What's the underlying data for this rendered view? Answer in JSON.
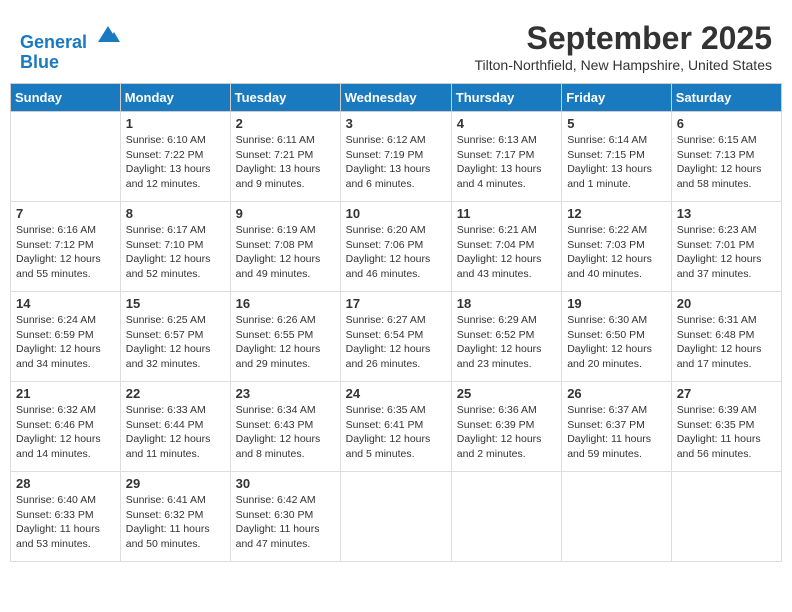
{
  "header": {
    "logo_line1": "General",
    "logo_line2": "Blue",
    "month_title": "September 2025",
    "location": "Tilton-Northfield, New Hampshire, United States"
  },
  "days_of_week": [
    "Sunday",
    "Monday",
    "Tuesday",
    "Wednesday",
    "Thursday",
    "Friday",
    "Saturday"
  ],
  "weeks": [
    [
      {
        "day": "",
        "info": ""
      },
      {
        "day": "1",
        "info": "Sunrise: 6:10 AM\nSunset: 7:22 PM\nDaylight: 13 hours\nand 12 minutes."
      },
      {
        "day": "2",
        "info": "Sunrise: 6:11 AM\nSunset: 7:21 PM\nDaylight: 13 hours\nand 9 minutes."
      },
      {
        "day": "3",
        "info": "Sunrise: 6:12 AM\nSunset: 7:19 PM\nDaylight: 13 hours\nand 6 minutes."
      },
      {
        "day": "4",
        "info": "Sunrise: 6:13 AM\nSunset: 7:17 PM\nDaylight: 13 hours\nand 4 minutes."
      },
      {
        "day": "5",
        "info": "Sunrise: 6:14 AM\nSunset: 7:15 PM\nDaylight: 13 hours\nand 1 minute."
      },
      {
        "day": "6",
        "info": "Sunrise: 6:15 AM\nSunset: 7:13 PM\nDaylight: 12 hours\nand 58 minutes."
      }
    ],
    [
      {
        "day": "7",
        "info": "Sunrise: 6:16 AM\nSunset: 7:12 PM\nDaylight: 12 hours\nand 55 minutes."
      },
      {
        "day": "8",
        "info": "Sunrise: 6:17 AM\nSunset: 7:10 PM\nDaylight: 12 hours\nand 52 minutes."
      },
      {
        "day": "9",
        "info": "Sunrise: 6:19 AM\nSunset: 7:08 PM\nDaylight: 12 hours\nand 49 minutes."
      },
      {
        "day": "10",
        "info": "Sunrise: 6:20 AM\nSunset: 7:06 PM\nDaylight: 12 hours\nand 46 minutes."
      },
      {
        "day": "11",
        "info": "Sunrise: 6:21 AM\nSunset: 7:04 PM\nDaylight: 12 hours\nand 43 minutes."
      },
      {
        "day": "12",
        "info": "Sunrise: 6:22 AM\nSunset: 7:03 PM\nDaylight: 12 hours\nand 40 minutes."
      },
      {
        "day": "13",
        "info": "Sunrise: 6:23 AM\nSunset: 7:01 PM\nDaylight: 12 hours\nand 37 minutes."
      }
    ],
    [
      {
        "day": "14",
        "info": "Sunrise: 6:24 AM\nSunset: 6:59 PM\nDaylight: 12 hours\nand 34 minutes."
      },
      {
        "day": "15",
        "info": "Sunrise: 6:25 AM\nSunset: 6:57 PM\nDaylight: 12 hours\nand 32 minutes."
      },
      {
        "day": "16",
        "info": "Sunrise: 6:26 AM\nSunset: 6:55 PM\nDaylight: 12 hours\nand 29 minutes."
      },
      {
        "day": "17",
        "info": "Sunrise: 6:27 AM\nSunset: 6:54 PM\nDaylight: 12 hours\nand 26 minutes."
      },
      {
        "day": "18",
        "info": "Sunrise: 6:29 AM\nSunset: 6:52 PM\nDaylight: 12 hours\nand 23 minutes."
      },
      {
        "day": "19",
        "info": "Sunrise: 6:30 AM\nSunset: 6:50 PM\nDaylight: 12 hours\nand 20 minutes."
      },
      {
        "day": "20",
        "info": "Sunrise: 6:31 AM\nSunset: 6:48 PM\nDaylight: 12 hours\nand 17 minutes."
      }
    ],
    [
      {
        "day": "21",
        "info": "Sunrise: 6:32 AM\nSunset: 6:46 PM\nDaylight: 12 hours\nand 14 minutes."
      },
      {
        "day": "22",
        "info": "Sunrise: 6:33 AM\nSunset: 6:44 PM\nDaylight: 12 hours\nand 11 minutes."
      },
      {
        "day": "23",
        "info": "Sunrise: 6:34 AM\nSunset: 6:43 PM\nDaylight: 12 hours\nand 8 minutes."
      },
      {
        "day": "24",
        "info": "Sunrise: 6:35 AM\nSunset: 6:41 PM\nDaylight: 12 hours\nand 5 minutes."
      },
      {
        "day": "25",
        "info": "Sunrise: 6:36 AM\nSunset: 6:39 PM\nDaylight: 12 hours\nand 2 minutes."
      },
      {
        "day": "26",
        "info": "Sunrise: 6:37 AM\nSunset: 6:37 PM\nDaylight: 11 hours\nand 59 minutes."
      },
      {
        "day": "27",
        "info": "Sunrise: 6:39 AM\nSunset: 6:35 PM\nDaylight: 11 hours\nand 56 minutes."
      }
    ],
    [
      {
        "day": "28",
        "info": "Sunrise: 6:40 AM\nSunset: 6:33 PM\nDaylight: 11 hours\nand 53 minutes."
      },
      {
        "day": "29",
        "info": "Sunrise: 6:41 AM\nSunset: 6:32 PM\nDaylight: 11 hours\nand 50 minutes."
      },
      {
        "day": "30",
        "info": "Sunrise: 6:42 AM\nSunset: 6:30 PM\nDaylight: 11 hours\nand 47 minutes."
      },
      {
        "day": "",
        "info": ""
      },
      {
        "day": "",
        "info": ""
      },
      {
        "day": "",
        "info": ""
      },
      {
        "day": "",
        "info": ""
      }
    ]
  ]
}
